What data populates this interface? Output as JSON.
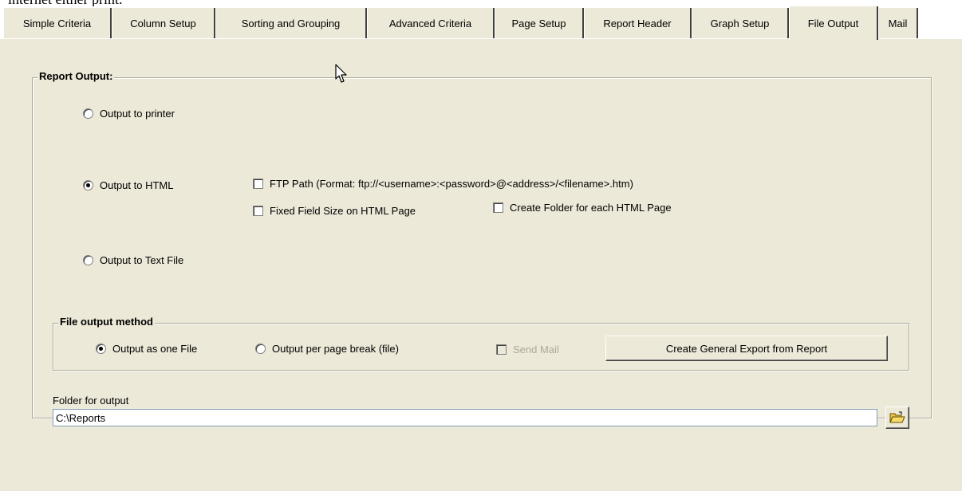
{
  "doc_strip_text": "internet either print.",
  "tabs": [
    {
      "label": "Simple Criteria",
      "active": false
    },
    {
      "label": "Column Setup",
      "active": false
    },
    {
      "label": "Sorting and Grouping",
      "active": false
    },
    {
      "label": "Advanced Criteria",
      "active": false
    },
    {
      "label": "Page Setup",
      "active": false
    },
    {
      "label": "Report Header",
      "active": false
    },
    {
      "label": "Graph Setup",
      "active": false
    },
    {
      "label": "File Output",
      "active": true
    },
    {
      "label": "Mail",
      "active": false
    }
  ],
  "report_output": {
    "title": "Report Output:",
    "options": [
      {
        "label": "Output to printer",
        "checked": false
      },
      {
        "label": "Output to HTML",
        "checked": true
      },
      {
        "label": "Output to Text File",
        "checked": false
      }
    ],
    "html_options": {
      "ftp_path": {
        "label": "FTP Path (Format: ftp://<username>:<password>@<address>/<filename>.htm)",
        "checked": false
      },
      "fixed_field_size": {
        "label": "Fixed Field Size on HTML Page",
        "checked": false
      },
      "create_folder": {
        "label": "Create Folder for each HTML Page",
        "checked": false
      }
    }
  },
  "file_output_method": {
    "title": "File output method",
    "one_file": {
      "label": "Output as one File",
      "checked": true
    },
    "per_page": {
      "label": "Output per page break (file)",
      "checked": false
    },
    "send_mail": {
      "label": "Send Mail",
      "checked": false,
      "disabled": true
    },
    "export_button": "Create General Export from Report"
  },
  "folder": {
    "label": "Folder for output",
    "value": "C:\\Reports",
    "browse_icon": "open-folder-icon"
  }
}
